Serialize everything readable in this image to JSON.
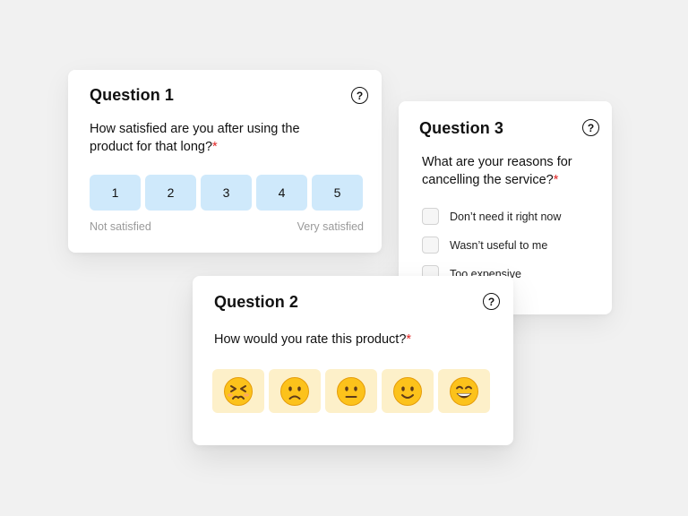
{
  "q1": {
    "title": "Question 1",
    "help": "?",
    "question": "How satisfied are you after using the product for that long?",
    "required": "*",
    "scale": [
      "1",
      "2",
      "3",
      "4",
      "5"
    ],
    "low_label": "Not satisfied",
    "high_label": "Very satisfied",
    "accent": "#cfe9fb"
  },
  "q2": {
    "title": "Question 2",
    "help": "?",
    "question": "How would you rate this product?",
    "required": "*",
    "ratings": [
      "persevering-face-icon",
      "slightly-frowning-face-icon",
      "neutral-face-icon",
      "slightly-smiling-face-icon",
      "grinning-face-icon"
    ],
    "accent": "#fdf0c9"
  },
  "q3": {
    "title": "Question 3",
    "help": "?",
    "question": "What are your reasons for cancelling the service?",
    "required": "*",
    "options": [
      "Don’t need it right now",
      "Wasn’t useful to me",
      "Too expensive"
    ]
  },
  "colors": {
    "required": "#e02424",
    "background": "#f1f1f1"
  }
}
